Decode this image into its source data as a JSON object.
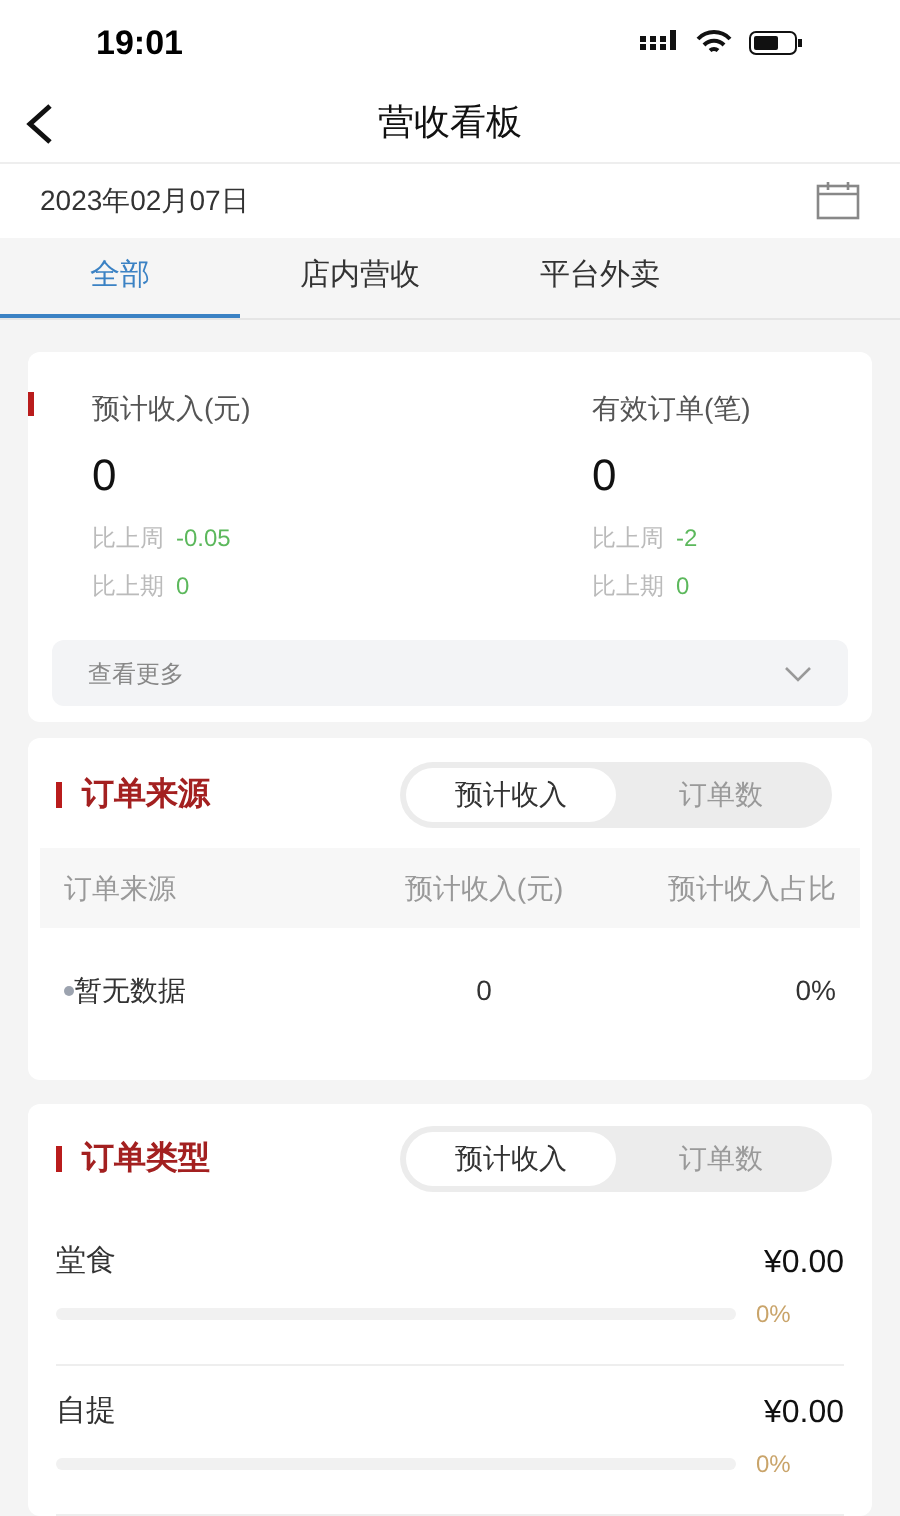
{
  "status_bar": {
    "time": "19:01"
  },
  "nav": {
    "title": "营收看板"
  },
  "date": "2023年02月07日",
  "tabs": [
    {
      "label": "全部",
      "selected": true
    },
    {
      "label": "店内营收",
      "selected": false
    },
    {
      "label": "平台外卖",
      "selected": false
    }
  ],
  "summary": {
    "metrics": [
      {
        "label": "预计收入(元)",
        "value": "0",
        "comparisons": [
          {
            "label": "比上周",
            "value": "-0.05"
          },
          {
            "label": "比上期",
            "value": "0"
          }
        ]
      },
      {
        "label": "有效订单(笔)",
        "value": "0",
        "comparisons": [
          {
            "label": "比上周",
            "value": "-2"
          },
          {
            "label": "比上期",
            "value": "0"
          }
        ]
      }
    ],
    "more": {
      "label": "查看更多",
      "expanded": false
    }
  },
  "order_source": {
    "title": "订单来源",
    "toggle": [
      {
        "label": "预计收入",
        "selected": true
      },
      {
        "label": "订单数",
        "selected": false
      }
    ],
    "columns": [
      "订单来源",
      "预计收入(元)",
      "预计收入占比"
    ],
    "rows": [
      {
        "cells": [
          "暂无数据",
          "0",
          "0%"
        ],
        "color": "#9ca3af"
      }
    ]
  },
  "order_type": {
    "title": "订单类型",
    "toggle": [
      {
        "label": "预计收入",
        "selected": true
      },
      {
        "label": "订单数",
        "selected": false
      }
    ],
    "items": [
      {
        "name": "堂食",
        "amount": "¥0.00",
        "share": "0%"
      },
      {
        "name": "自提",
        "amount": "¥0.00",
        "share": "0%"
      }
    ]
  }
}
